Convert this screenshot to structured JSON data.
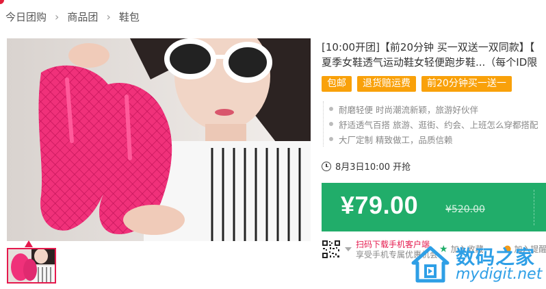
{
  "breadcrumb": {
    "items": [
      "今日团购",
      "商品团",
      "鞋包"
    ],
    "separator": "›"
  },
  "product": {
    "title_line1": "[10:00开团]【前20分钟 买一双送一双同款】【",
    "title_line2": "夏季女鞋透气运动鞋女轻便跑步鞋...（每个ID限",
    "tags": [
      "包邮",
      "退货赔运费",
      "前20分钟买一送一"
    ],
    "features": [
      "耐磨轻便 时尚潮流新颖，旅游好伙伴",
      "舒适透气百搭 旅游、逛街、约会、上班怎么穿都搭配",
      "大厂定制 精致做工，品质信赖"
    ],
    "start_time": "8月3日10:00 开抢",
    "price": "¥79.00",
    "original_price": "¥520.00"
  },
  "app": {
    "line1": "扫码下载手机客户端",
    "line2": "享受手机专属优惠机会",
    "fav_label": "加入收藏",
    "cart_label": "加入提醒"
  },
  "watermark": {
    "cn": "数码之家",
    "en": "mydigit.net"
  },
  "colors": {
    "accent_green": "#21ad6a",
    "tag_orange": "#f9a10a",
    "thumb_pink": "#e5194d",
    "watermark_blue": "#2e9fe6"
  },
  "icons": {
    "clock": "clock-icon",
    "star": "star-icon",
    "cart": "cart-icon",
    "caret": "caret-down-icon"
  }
}
